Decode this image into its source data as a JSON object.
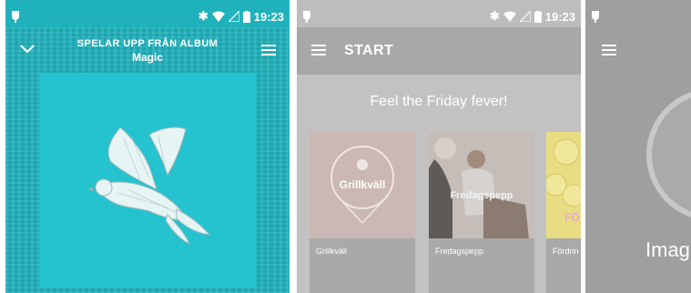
{
  "status_bar": {
    "time": "19:23"
  },
  "player": {
    "playing_from": "SPELAR UPP FRÅN ALBUM",
    "album_name": "Magic"
  },
  "browse": {
    "title": "START",
    "headline": "Feel the Friday fever!",
    "cards": [
      {
        "label": "Grillkväll",
        "art_text": "Grillkväll"
      },
      {
        "label": "Fredagspepp",
        "art_text": "Fredagspepp"
      },
      {
        "label": "Fördrin",
        "art_text": "FÖ"
      }
    ]
  },
  "third": {
    "partial_title": "Imag"
  },
  "colors": {
    "player_bg": "#1fb2bd",
    "browse_bg": "#bdbdbd"
  }
}
